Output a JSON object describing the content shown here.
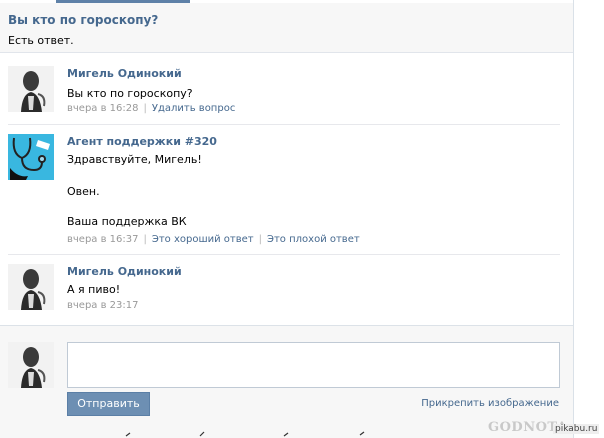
{
  "question": {
    "title": "Вы кто по гороскопу?",
    "status": "Есть ответ."
  },
  "messages": [
    {
      "author": "Мигель Одинокий",
      "lines": [
        "Вы кто по гороскопу?"
      ],
      "time": "вчера в 16:28",
      "actions": [
        "Удалить вопрос"
      ]
    },
    {
      "author": "Агент поддержки #320",
      "lines": [
        "Здравствуйте, Мигель!",
        "Овен.",
        "Ваша поддержка ВК"
      ],
      "time": "вчера в 16:37",
      "actions": [
        "Это хороший ответ",
        "Это плохой ответ"
      ]
    },
    {
      "author": "Мигель Одинокий",
      "lines": [
        "А я пиво!"
      ],
      "time": "вчера в 23:17",
      "actions": []
    }
  ],
  "form": {
    "input_value": "",
    "send_label": "Отправить",
    "attach_label": "Прикрепить изображение"
  },
  "watermarks": {
    "godnota": "GODNOTA",
    "pikabu": "pikabu.ru"
  },
  "colors": {
    "link": "#45688e",
    "button": "#6d8fb3",
    "meta": "#999999"
  },
  "icons": {
    "user_avatar": "user-photo-avatar",
    "agent_avatar": "stethoscope-avatar"
  }
}
